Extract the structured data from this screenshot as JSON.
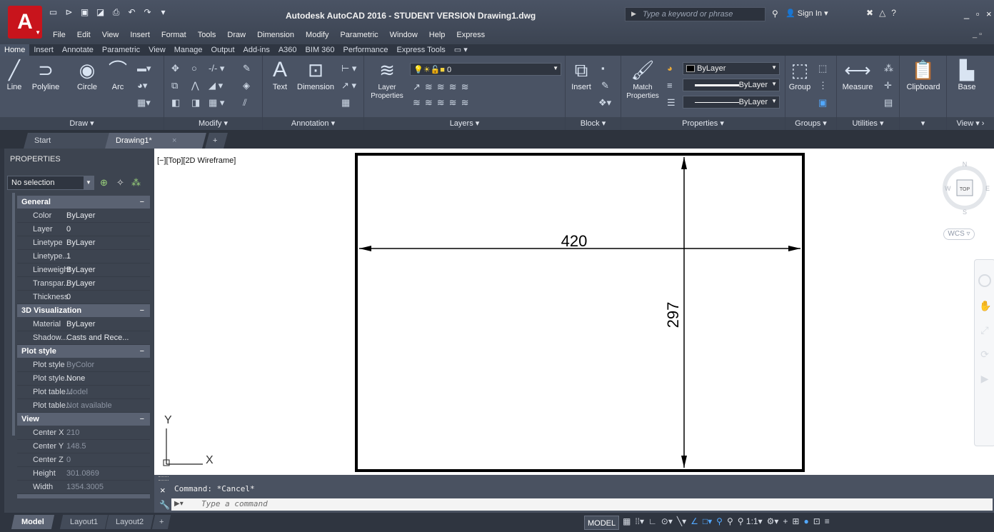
{
  "app": {
    "logo": "A",
    "title": "Autodesk AutoCAD 2016 - STUDENT VERSION    Drawing1.dwg",
    "search_placeholder": "Type a keyword or phrase",
    "sign_in": "Sign In",
    "window_controls": "_ ▫ ×"
  },
  "quick_access": [
    "new-icon",
    "open-icon",
    "save-icon",
    "save-as-icon",
    "print-icon",
    "undo-icon",
    "redo-icon",
    "more-icon"
  ],
  "menu": [
    "File",
    "Edit",
    "View",
    "Insert",
    "Format",
    "Tools",
    "Draw",
    "Dimension",
    "Modify",
    "Parametric",
    "Window",
    "Help",
    "Express"
  ],
  "ribbon_tabs": [
    "Home",
    "Insert",
    "Annotate",
    "Parametric",
    "View",
    "Manage",
    "Output",
    "Add-ins",
    "A360",
    "BIM 360",
    "Performance",
    "Express Tools"
  ],
  "ribbon": {
    "draw": {
      "title": "Draw",
      "line": "Line",
      "polyline": "Polyline",
      "circle": "Circle",
      "arc": "Arc"
    },
    "modify": {
      "title": "Modify"
    },
    "annotation": {
      "title": "Annotation",
      "text": "Text",
      "dimension": "Dimension"
    },
    "layers": {
      "title": "Layers",
      "layer_properties": "Layer Properties",
      "current_layer": "0"
    },
    "block": {
      "title": "Block",
      "insert": "Insert"
    },
    "properties": {
      "title": "Properties",
      "match": "Match Properties",
      "color": "ByLayer",
      "linetype": "ByLayer",
      "lineweight": "ByLayer"
    },
    "groups": {
      "title": "Groups",
      "group": "Group"
    },
    "utilities": {
      "title": "Utilities",
      "measure": "Measure"
    },
    "clipboard": {
      "title": "Clipboard"
    },
    "view": {
      "title": "View",
      "base": "Base"
    }
  },
  "doc_tabs": {
    "start": "Start",
    "drawing": "Drawing1*"
  },
  "properties": {
    "title": "PROPERTIES",
    "selection": "No selection",
    "sections": [
      {
        "name": "General",
        "rows": [
          {
            "key": "Color",
            "value": "ByLayer"
          },
          {
            "key": "Layer",
            "value": "0"
          },
          {
            "key": "Linetype",
            "value": "ByLayer"
          },
          {
            "key": "Linetype...",
            "value": "1"
          },
          {
            "key": "Lineweight",
            "value": "ByLayer"
          },
          {
            "key": "Transpar...",
            "value": "ByLayer"
          },
          {
            "key": "Thickness",
            "value": "0"
          }
        ]
      },
      {
        "name": "3D Visualization",
        "rows": [
          {
            "key": "Material",
            "value": "ByLayer"
          },
          {
            "key": "Shadow...",
            "value": "Casts and Rece..."
          }
        ]
      },
      {
        "name": "Plot style",
        "rows": [
          {
            "key": "Plot style",
            "value": "ByColor"
          },
          {
            "key": "Plot style...",
            "value": "None"
          },
          {
            "key": "Plot table...",
            "value": "Model"
          },
          {
            "key": "Plot table...",
            "value": "Not available"
          }
        ]
      },
      {
        "name": "View",
        "rows": [
          {
            "key": "Center X",
            "value": "210"
          },
          {
            "key": "Center Y",
            "value": "148.5"
          },
          {
            "key": "Center Z",
            "value": "0"
          },
          {
            "key": "Height",
            "value": "301.0869"
          },
          {
            "key": "Width",
            "value": "1354.3005"
          }
        ]
      }
    ]
  },
  "viewport": {
    "label": "[−][Top][2D Wireframe]",
    "dim_horizontal": "420",
    "dim_vertical": "297",
    "ucs_x": "X",
    "ucs_y": "Y",
    "viewcube": {
      "n": "N",
      "s": "S",
      "w": "W",
      "e": "E",
      "top": "TOP"
    },
    "wcs": "WCS"
  },
  "command": {
    "history": "Command: *Cancel*",
    "placeholder": "Type a command"
  },
  "layout_tabs": [
    "Model",
    "Layout1",
    "Layout2"
  ],
  "status": {
    "model": "MODEL",
    "scale": "1:1"
  }
}
